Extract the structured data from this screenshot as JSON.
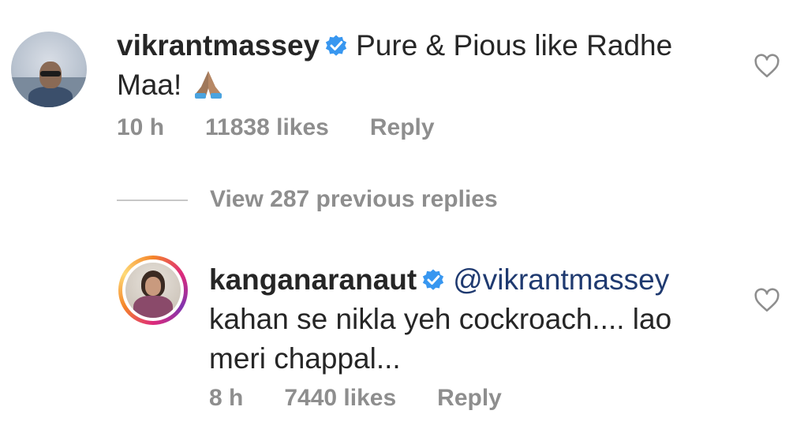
{
  "comments": [
    {
      "username": "vikrantmassey",
      "text_line1": "Pure & Pious like Radhe",
      "text_line2": "Maa!",
      "emoji": "folded-hands-emoji",
      "time": "10 h",
      "likes": "11838 likes",
      "reply_label": "Reply"
    },
    {
      "username": "kanganaranaut",
      "mention": "@vikrantmassey",
      "text_line1": "kahan se nikla yeh cockroach.... lao",
      "text_line2": "meri chappal...",
      "time": "8 h",
      "likes": "7440 likes",
      "reply_label": "Reply"
    }
  ],
  "view_replies_label": "View 287 previous replies",
  "colors": {
    "verified": "#3897f0",
    "meta_text": "#8e8e8e",
    "mention": "#1f3a70"
  }
}
